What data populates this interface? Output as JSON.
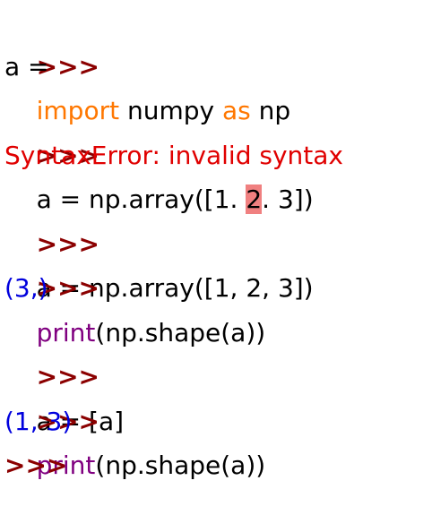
{
  "shell": {
    "prompt": ">>>",
    "colors": {
      "prompt": "#8b0000",
      "keyword": "#ff7700",
      "builtin": "#800080",
      "error": "#e00000",
      "output": "#0000dd",
      "error_highlight": "#f08080"
    },
    "lines": [
      {
        "type": "input",
        "segments": [
          {
            "text": "import",
            "kind": "keyword"
          },
          {
            "text": " numpy ",
            "kind": "plain"
          },
          {
            "text": "as",
            "kind": "keyword"
          },
          {
            "text": " np",
            "kind": "plain"
          }
        ]
      },
      {
        "type": "continuation",
        "segments": [
          {
            "text": "a =",
            "kind": "plain"
          }
        ]
      },
      {
        "type": "input",
        "segments": [
          {
            "text": "a = np.array([1. ",
            "kind": "plain"
          },
          {
            "text": "2",
            "kind": "highlight"
          },
          {
            "text": ". 3])",
            "kind": "plain"
          }
        ]
      },
      {
        "type": "error",
        "segments": [
          {
            "text": "SyntaxError: invalid syntax",
            "kind": "error"
          }
        ]
      },
      {
        "type": "input",
        "segments": [
          {
            "text": "a = np.array([1, 2, 3])",
            "kind": "plain"
          }
        ]
      },
      {
        "type": "input",
        "segments": [
          {
            "text": "print",
            "kind": "builtin"
          },
          {
            "text": "(np.shape(a))",
            "kind": "plain"
          }
        ]
      },
      {
        "type": "output",
        "segments": [
          {
            "text": "(3,)",
            "kind": "output"
          }
        ]
      },
      {
        "type": "input",
        "segments": [
          {
            "text": "a = [a]",
            "kind": "plain"
          }
        ]
      },
      {
        "type": "input",
        "segments": [
          {
            "text": "print",
            "kind": "builtin"
          },
          {
            "text": "(np.shape(a))",
            "kind": "plain"
          }
        ]
      },
      {
        "type": "output",
        "segments": [
          {
            "text": "(1, 3)",
            "kind": "output"
          }
        ]
      },
      {
        "type": "input",
        "segments": []
      }
    ]
  }
}
